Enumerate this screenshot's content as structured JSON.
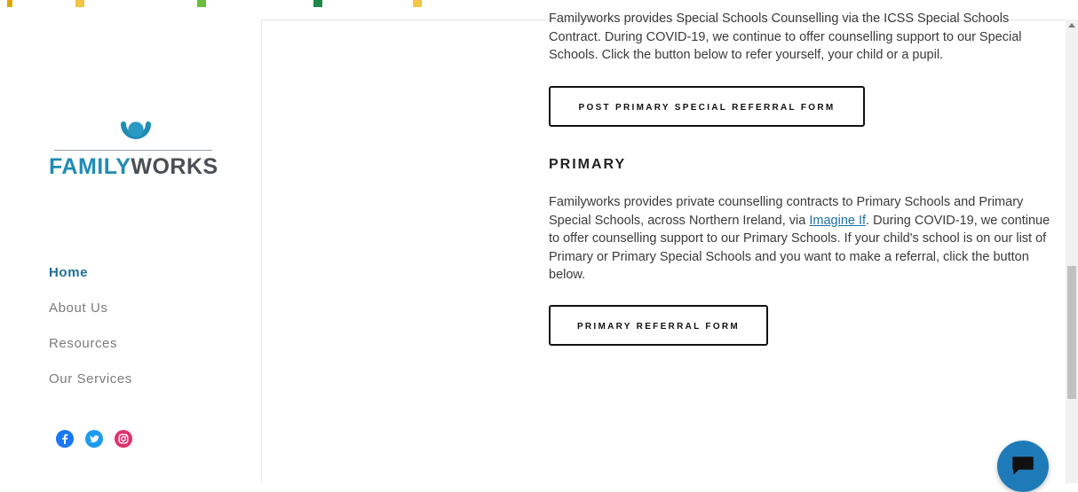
{
  "colors": {
    "brand_blue": "#1f8cb5",
    "brand_grey": "#4a4f55",
    "nav_active": "#1f6f96",
    "chat_blue": "#1f7ab8"
  },
  "logo": {
    "part1": "FAMILY",
    "part2": "WORKS",
    "icon": "familyworks-logo-mark"
  },
  "nav": {
    "items": [
      {
        "label": "Home",
        "active": true
      },
      {
        "label": "About Us",
        "active": false
      },
      {
        "label": "Resources",
        "active": false
      },
      {
        "label": "Our Services",
        "active": false
      }
    ]
  },
  "social": {
    "icons": [
      "facebook-icon",
      "twitter-icon",
      "instagram-icon"
    ]
  },
  "content": {
    "special_text": "Familyworks provides Special Schools Counselling via the ICSS Special Schools Contract. During COVID-19, we continue to offer counselling support to our Special Schools. Click the button below to refer yourself, your child or a pupil.",
    "special_button": "POST PRIMARY SPECIAL REFERRAL FORM",
    "primary_heading": "PRIMARY",
    "primary_text_before": "Familyworks provides private counselling contracts to Primary Schools and Primary Special Schools, across Northern Ireland, via ",
    "primary_link": "Imagine If",
    "primary_text_after": ". During COVID-19, we continue to offer counselling support to our Primary Schools. If your child's school is on our list of Primary or Primary Special Schools and you want to make a referral, click the button below.",
    "primary_button": "PRIMARY REFERRAL FORM"
  },
  "chat": {
    "icon": "chat-icon"
  }
}
